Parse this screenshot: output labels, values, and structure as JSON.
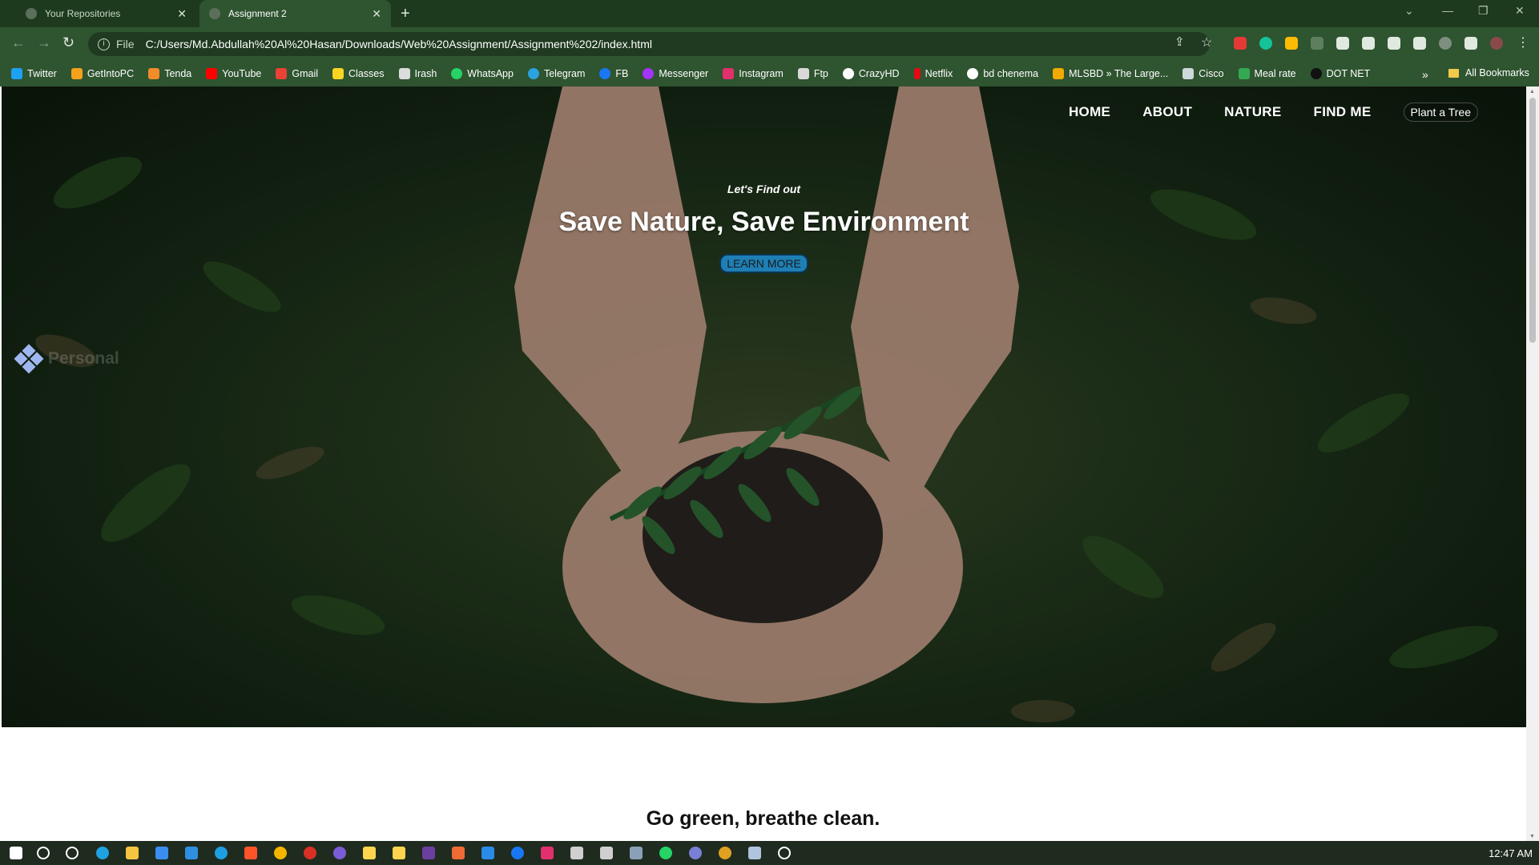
{
  "browser": {
    "tabs": [
      {
        "title": "Your Repositories",
        "active": false
      },
      {
        "title": "Assignment 2",
        "active": true
      }
    ],
    "address": {
      "scheme": "File",
      "url": "C:/Users/Md.Abdullah%20Al%20Hasan/Downloads/Web%20Assignment/Assignment%202/index.html"
    },
    "bookmarks": [
      {
        "label": "Twitter",
        "color": "#1da1f2"
      },
      {
        "label": "GetIntoPC",
        "color": "#f4a21c"
      },
      {
        "label": "Tenda",
        "color": "#f28c28"
      },
      {
        "label": "YouTube",
        "color": "#ff0000"
      },
      {
        "label": "Gmail",
        "color": "#ea4335"
      },
      {
        "label": "Classes",
        "color": "#f9d423"
      },
      {
        "label": "Irash",
        "color": "#dcdcdc"
      },
      {
        "label": "WhatsApp",
        "color": "#25d366"
      },
      {
        "label": "Telegram",
        "color": "#2aa3df"
      },
      {
        "label": "FB",
        "color": "#1877f2"
      },
      {
        "label": "Messenger",
        "color": "#a334fa"
      },
      {
        "label": "Instagram",
        "color": "#e1306c"
      },
      {
        "label": "Ftp",
        "color": "#d9d9d9"
      },
      {
        "label": "CrazyHD",
        "color": "#ffffff"
      },
      {
        "label": "Netflix",
        "color": "#e50914"
      },
      {
        "label": "bd chenema",
        "color": "#ffffff"
      },
      {
        "label": "MLSBD » The Large...",
        "color": "#f2a900"
      },
      {
        "label": "Cisco",
        "color": "#cfd8dc"
      },
      {
        "label": "Meal rate",
        "color": "#34a853"
      },
      {
        "label": "DOT NET",
        "color": "#111111"
      }
    ],
    "bookmarks_more": "»",
    "all_bookmarks": "All Bookmarks"
  },
  "page": {
    "nav": {
      "home": "HOME",
      "about": "ABOUT",
      "nature": "NATURE",
      "find_me": "FIND ME",
      "plant": "Plant a Tree"
    },
    "brand": "Personal",
    "hero": {
      "eyebrow": "Let's Find out",
      "title": "Save Nature, Save Environment",
      "button": "LEARN MORE"
    },
    "tagline": "Go green, breathe clean."
  },
  "taskbar": {
    "time": "12:47 AM"
  },
  "colors": {
    "chrome_dark": "#1e3a1e",
    "chrome": "#2f5430",
    "learn_more": "#1e7fb5"
  }
}
